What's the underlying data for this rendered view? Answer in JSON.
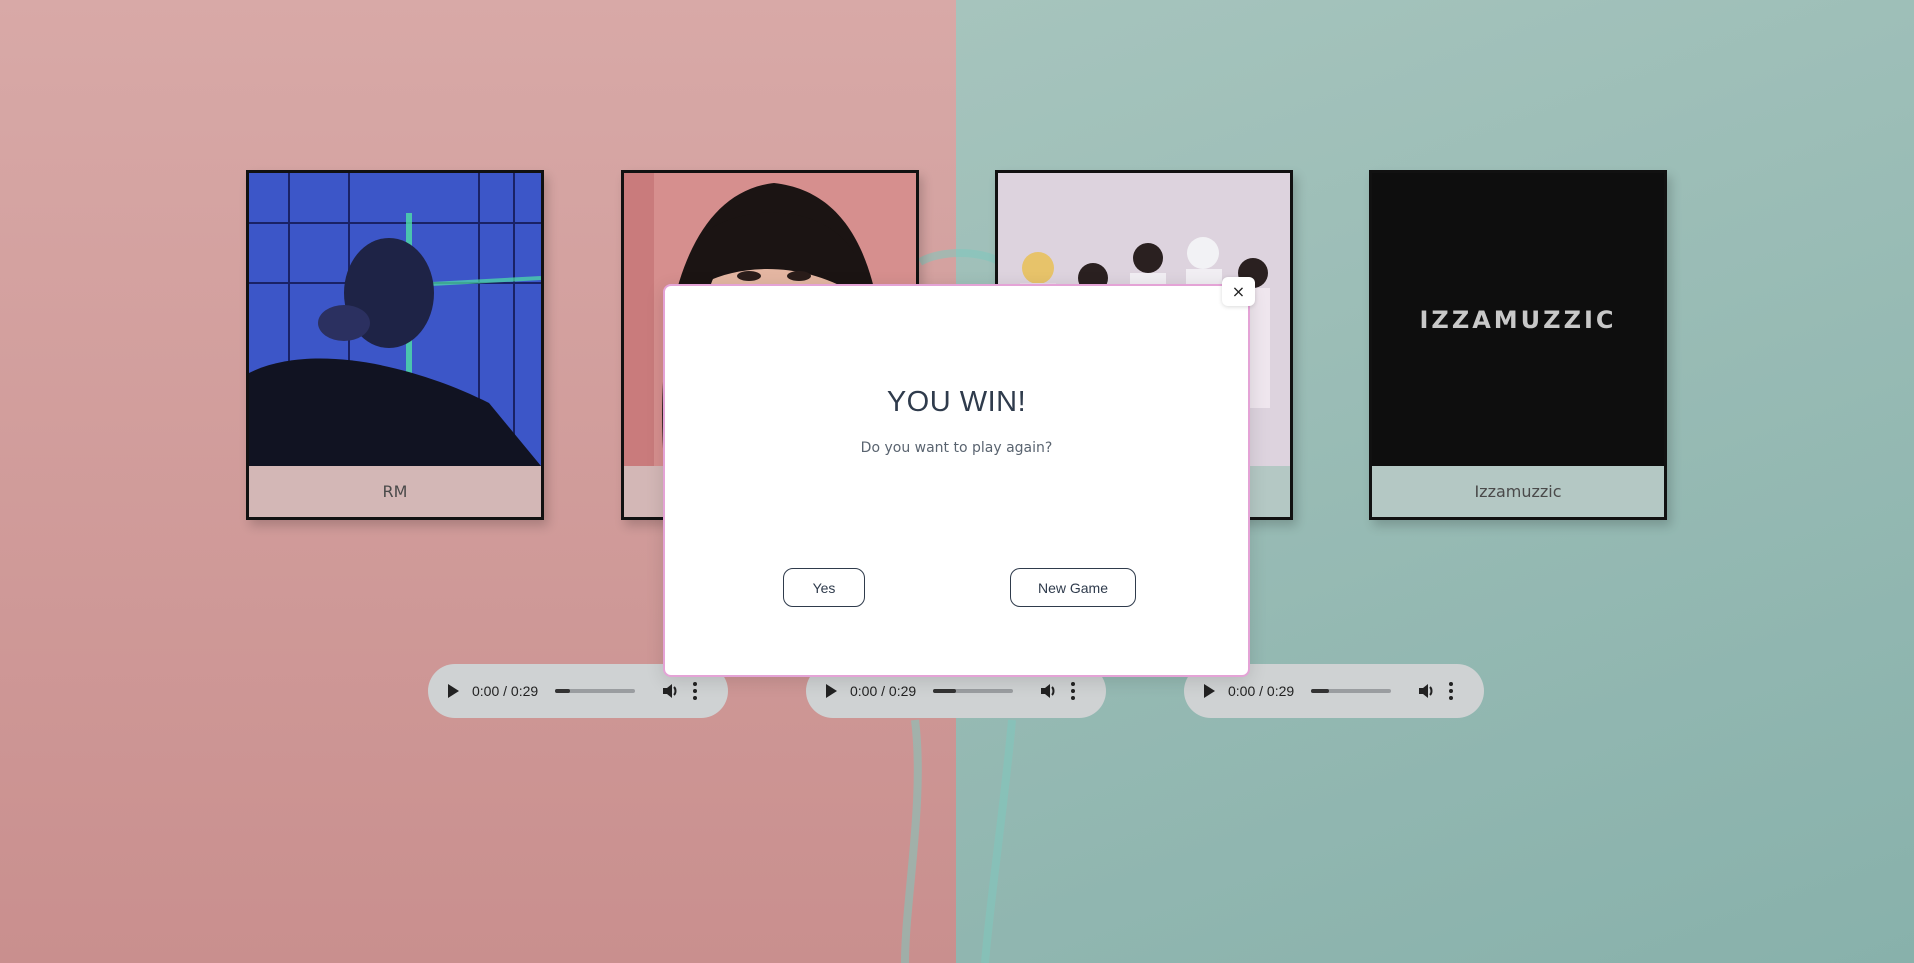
{
  "cards": [
    {
      "label": "RM",
      "theme": "pink",
      "art": "person-portrait-blue"
    },
    {
      "label": "",
      "theme": "pink",
      "art": "person-portrait-pink"
    },
    {
      "label": "",
      "theme": "teal",
      "art": "group-photo"
    },
    {
      "label": "Izzamuzzic",
      "theme": "teal",
      "art": "logo-wordmark",
      "logo_text": "IZZAMUZZIC"
    }
  ],
  "players": [
    {
      "time": "0:00 / 0:29",
      "progress": 0.18
    },
    {
      "time": "0:00 / 0:29",
      "progress": 0.28
    },
    {
      "time": "0:00 / 0:29",
      "progress": 0.22
    }
  ],
  "modal": {
    "title": "YOU WIN!",
    "subtitle": "Do you want to play again?",
    "yes_label": "Yes",
    "new_game_label": "New Game",
    "close_glyph": "×"
  },
  "colors": {
    "left_bg": "#d8a9a7",
    "right_bg": "#a6c4bd",
    "modal_border": "#e4a3d6",
    "text_dark": "#2f3b4c"
  }
}
